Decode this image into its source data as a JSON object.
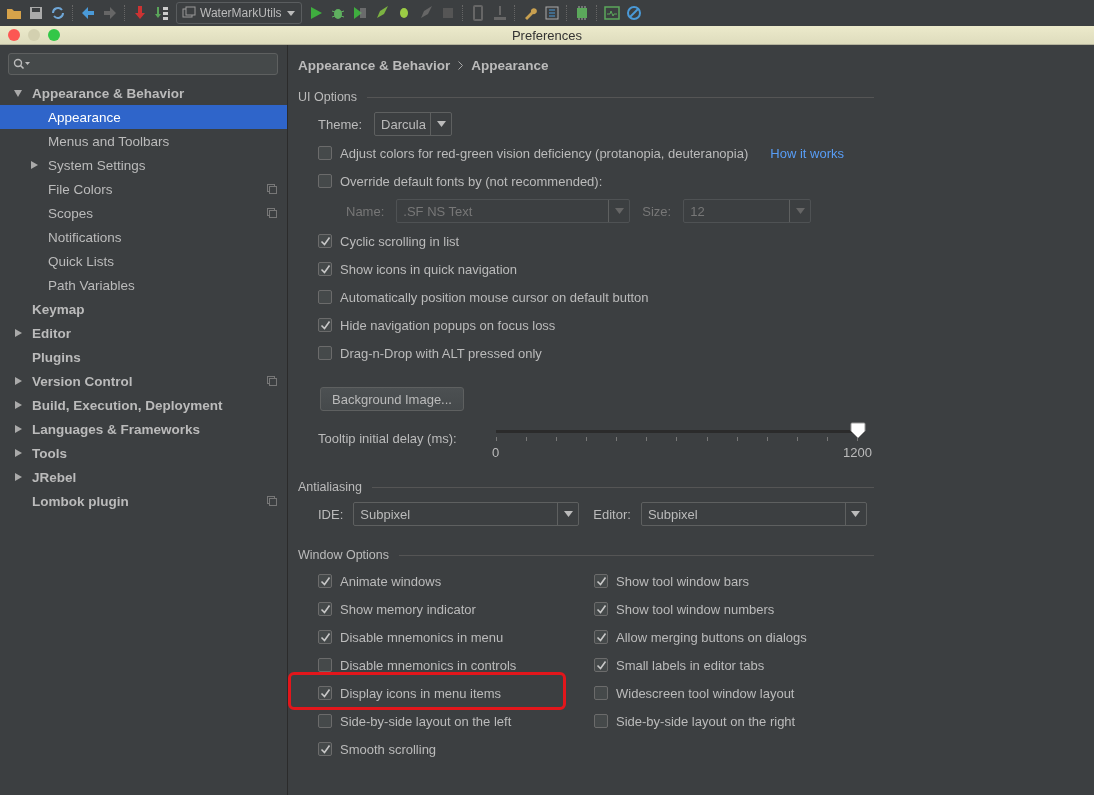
{
  "toolbar": {
    "run_config": "WaterMarkUtils"
  },
  "window": {
    "title": "Preferences"
  },
  "sidebar": {
    "items": [
      {
        "label": "Appearance & Behavior",
        "selected": false,
        "expanded": true,
        "project_setting": false,
        "children": [
          {
            "label": "Appearance",
            "selected": true,
            "project_setting": false
          },
          {
            "label": "Menus and Toolbars",
            "selected": false,
            "project_setting": false
          },
          {
            "label": "System Settings",
            "selected": false,
            "expanded": false,
            "project_setting": false
          },
          {
            "label": "File Colors",
            "selected": false,
            "project_setting": true
          },
          {
            "label": "Scopes",
            "selected": false,
            "project_setting": true
          },
          {
            "label": "Notifications",
            "selected": false,
            "project_setting": false
          },
          {
            "label": "Quick Lists",
            "selected": false,
            "project_setting": false
          },
          {
            "label": "Path Variables",
            "selected": false,
            "project_setting": false
          }
        ]
      },
      {
        "label": "Keymap",
        "selected": false,
        "project_setting": false
      },
      {
        "label": "Editor",
        "selected": false,
        "expanded": false,
        "project_setting": false
      },
      {
        "label": "Plugins",
        "selected": false,
        "project_setting": false
      },
      {
        "label": "Version Control",
        "selected": false,
        "expanded": false,
        "project_setting": true
      },
      {
        "label": "Build, Execution, Deployment",
        "selected": false,
        "expanded": false,
        "project_setting": false
      },
      {
        "label": "Languages & Frameworks",
        "selected": false,
        "expanded": false,
        "project_setting": false
      },
      {
        "label": "Tools",
        "selected": false,
        "expanded": false,
        "project_setting": false
      },
      {
        "label": "JRebel",
        "selected": false,
        "expanded": false,
        "project_setting": false
      },
      {
        "label": "Lombok plugin",
        "selected": false,
        "project_setting": true
      }
    ]
  },
  "breadcrumb": [
    "Appearance & Behavior",
    "Appearance"
  ],
  "ui_options": {
    "title": "UI Options",
    "theme": {
      "label": "Theme:",
      "value": "Darcula"
    },
    "rows": [
      {
        "kind": "checkbox",
        "label": "Adjust colors for red-green vision deficiency (protanopia, deuteranopia)",
        "checked": false,
        "link": "How it works"
      },
      {
        "kind": "checkbox",
        "label": "Override default fonts by (not recommended):",
        "checked": false
      },
      {
        "kind": "font",
        "name_label": "Name:",
        "name_value": ".SF NS Text",
        "size_label": "Size:",
        "size_value": "12",
        "disabled": true
      },
      {
        "kind": "checkbox",
        "label": "Cyclic scrolling in list",
        "checked": true
      },
      {
        "kind": "checkbox",
        "label": "Show icons in quick navigation",
        "checked": true
      },
      {
        "kind": "checkbox",
        "label": "Automatically position mouse cursor on default button",
        "checked": false
      },
      {
        "kind": "checkbox",
        "label": "Hide navigation popups on focus loss",
        "checked": true
      },
      {
        "kind": "checkbox",
        "label": "Drag-n-Drop with ALT pressed only",
        "checked": false
      },
      {
        "kind": "button",
        "label": "Background Image..."
      },
      {
        "kind": "slider",
        "label": "Tooltip initial delay (ms):",
        "level": 1,
        "min_label": "0",
        "max_label": "1200"
      }
    ]
  },
  "antialiasing": {
    "title": "Antialiasing",
    "ide": {
      "label": "IDE:",
      "value": "Subpixel"
    },
    "editor": {
      "label": "Editor:",
      "value": "Subpixel"
    }
  },
  "window_options": {
    "title": "Window Options",
    "left": [
      {
        "label": "Animate windows",
        "checked": true,
        "highlighted": false
      },
      {
        "label": "Show memory indicator",
        "checked": true,
        "highlighted": false
      },
      {
        "label": "Disable mnemonics in menu",
        "checked": true,
        "highlighted": false
      },
      {
        "label": "Disable mnemonics in controls",
        "checked": false,
        "highlighted": false
      },
      {
        "label": "Display icons in menu items",
        "checked": true,
        "highlighted": true
      },
      {
        "label": "Side-by-side layout on the left",
        "checked": false,
        "highlighted": false
      },
      {
        "label": "Smooth scrolling",
        "checked": true,
        "highlighted": false
      }
    ],
    "right": [
      {
        "label": "Show tool window bars",
        "checked": true,
        "highlighted": false
      },
      {
        "label": "Show tool window numbers",
        "checked": true,
        "highlighted": false
      },
      {
        "label": "Allow merging buttons on dialogs",
        "checked": true,
        "highlighted": false
      },
      {
        "label": "Small labels in editor tabs",
        "checked": true,
        "highlighted": false
      },
      {
        "label": "Widescreen tool window layout",
        "checked": false,
        "highlighted": false
      },
      {
        "label": "Side-by-side layout on the right",
        "checked": false,
        "highlighted": false
      }
    ]
  }
}
